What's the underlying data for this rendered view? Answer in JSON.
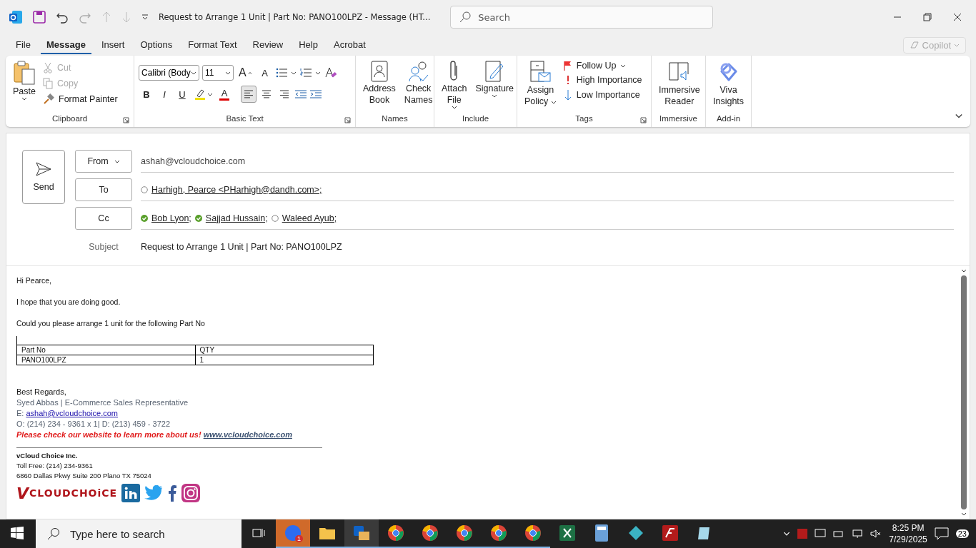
{
  "title_bar": {
    "title": "Request to Arrange 1 Unit  | Part No: PANO100LPZ  -  Message (HT...",
    "search_placeholder": "Search"
  },
  "menu_tabs": [
    {
      "label": "File",
      "selected": false
    },
    {
      "label": "Message",
      "selected": true
    },
    {
      "label": "Insert",
      "selected": false
    },
    {
      "label": "Options",
      "selected": false
    },
    {
      "label": "Format Text",
      "selected": false
    },
    {
      "label": "Review",
      "selected": false
    },
    {
      "label": "Help",
      "selected": false
    },
    {
      "label": "Acrobat",
      "selected": false
    }
  ],
  "copilot": {
    "label": "Copilot",
    "disabled": true
  },
  "ribbon": {
    "clipboard": {
      "label": "Clipboard",
      "paste": "Paste",
      "items": [
        {
          "label": "Cut",
          "disabled": true
        },
        {
          "label": "Copy",
          "disabled": true
        },
        {
          "label": "Format Painter",
          "disabled": false
        }
      ]
    },
    "basic_text": {
      "label": "Basic Text",
      "font": "Calibri (Body",
      "size": "11",
      "grow": "A",
      "shrink": "A",
      "styles": [
        {
          "glyph": "B"
        },
        {
          "glyph": "I"
        },
        {
          "glyph": "U"
        }
      ],
      "font_color": "A",
      "alignments": [
        {
          "kind": "left",
          "selected": true
        },
        {
          "kind": "center",
          "selected": false
        },
        {
          "kind": "right",
          "selected": false
        }
      ]
    },
    "names": {
      "label": "Names",
      "items": [
        {
          "lines": [
            "Address",
            "Book"
          ]
        },
        {
          "lines": [
            "Check",
            "Names"
          ]
        }
      ]
    },
    "include": {
      "label": "Include",
      "items": [
        {
          "lines": [
            "Attach",
            "File"
          ],
          "dropdown": true
        },
        {
          "lines": [
            "Signature"
          ],
          "dropdown": true
        }
      ]
    },
    "tags": {
      "label": "Tags",
      "assign": [
        "Assign",
        "Policy"
      ],
      "items": [
        {
          "kind": "flag",
          "label": "Follow Up"
        },
        {
          "kind": "high",
          "label": "High Importance"
        },
        {
          "kind": "low",
          "label": "Low Importance"
        }
      ]
    },
    "immersive": {
      "label": "Immersive",
      "lines": [
        "Immersive",
        "Reader"
      ]
    },
    "addin": {
      "label": "Add-in",
      "lines": [
        "Viva",
        "Insights"
      ]
    }
  },
  "compose": {
    "send": "Send",
    "from_button": "From",
    "from_value": "ashah@vcloudchoice.com",
    "to_button": "To",
    "to": [
      {
        "name": "Harhigh, Pearce <PHarhigh@dandh.com>;",
        "resolved": false
      }
    ],
    "cc_button": "Cc",
    "cc": [
      {
        "name": "Bob Lyon;",
        "resolved": true
      },
      {
        "name": "Sajjad Hussain;",
        "resolved": true
      },
      {
        "name": "Waleed Ayub;",
        "resolved": false
      }
    ],
    "subject_label": "Subject",
    "subject": "Request to Arrange 1 Unit  | Part No: PANO100LPZ"
  },
  "body": {
    "paragraphs": [
      "Hi Pearce,",
      "I hope that you are doing good.",
      "Could you please arrange 1 unit for the following Part No"
    ],
    "table": {
      "columns": [
        "Part No",
        "QTY"
      ],
      "rows": [
        [
          "PANO100LPZ",
          "1"
        ]
      ]
    },
    "signature": {
      "closing": "Best Regards,",
      "name_line": "Syed Abbas  | E-Commerce Sales Representative",
      "email_label": "E: ",
      "email": "ashah@vcloudchoice.com",
      "phone": "O: (214) 234 - 9361 x 1| D: (213) 459 - 3722",
      "promo": "Please check our website to learn more about us!",
      "website": "www.vcloudchoice.com",
      "company": "vCloud Choice Inc.",
      "toll_free": "Toll Free: (214) 234-9361",
      "address": "6860 Dallas Pkwy Suite 200 Plano TX 75024",
      "logo_v": "V",
      "logo_text": "CLOUDCHOiCE"
    }
  },
  "taskbar": {
    "search_placeholder": "Type here to search",
    "zoom_badge": "1",
    "time": "8:25 PM",
    "date": "7/29/2025",
    "notifications": "23"
  }
}
